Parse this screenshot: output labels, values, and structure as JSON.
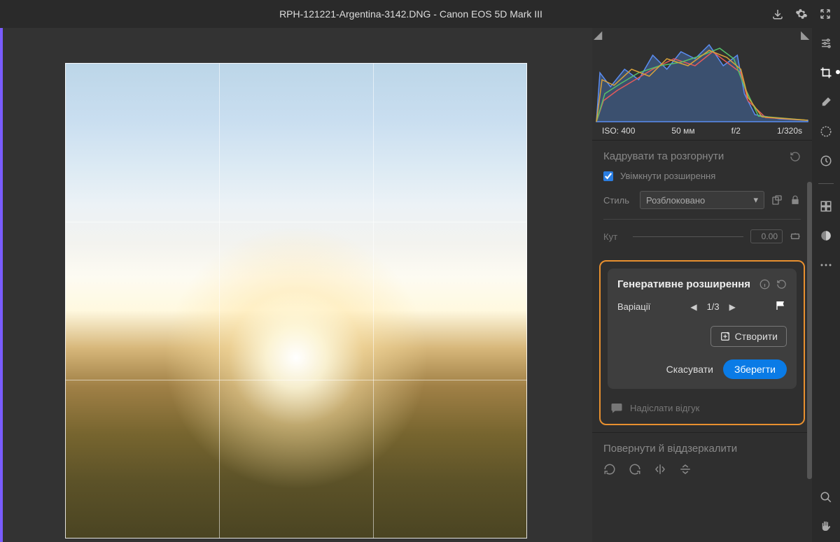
{
  "header": {
    "filename": "RPH-121221-Argentina-3142.DNG",
    "separator": "  -  ",
    "camera": "Canon EOS 5D Mark III"
  },
  "meta": {
    "iso_label": "ISO:",
    "iso": "400",
    "focal": "50 мм",
    "aperture": "f/2",
    "shutter": "1/320s"
  },
  "crop": {
    "title": "Кадрувати та розгорнути",
    "enable_expansion": "Увімкнути розширення",
    "style_label": "Стиль",
    "style_value": "Розблоковано",
    "angle_label": "Кут",
    "angle_value": "0.00"
  },
  "gen": {
    "title": "Генеративне розширення",
    "variations_label": "Варіації",
    "variation_index": "1/3",
    "create": "Створити",
    "cancel": "Скасувати",
    "save": "Зберегти",
    "feedback": "Надіслати відгук"
  },
  "rotate": {
    "title": "Повернути й віддзеркалити"
  }
}
